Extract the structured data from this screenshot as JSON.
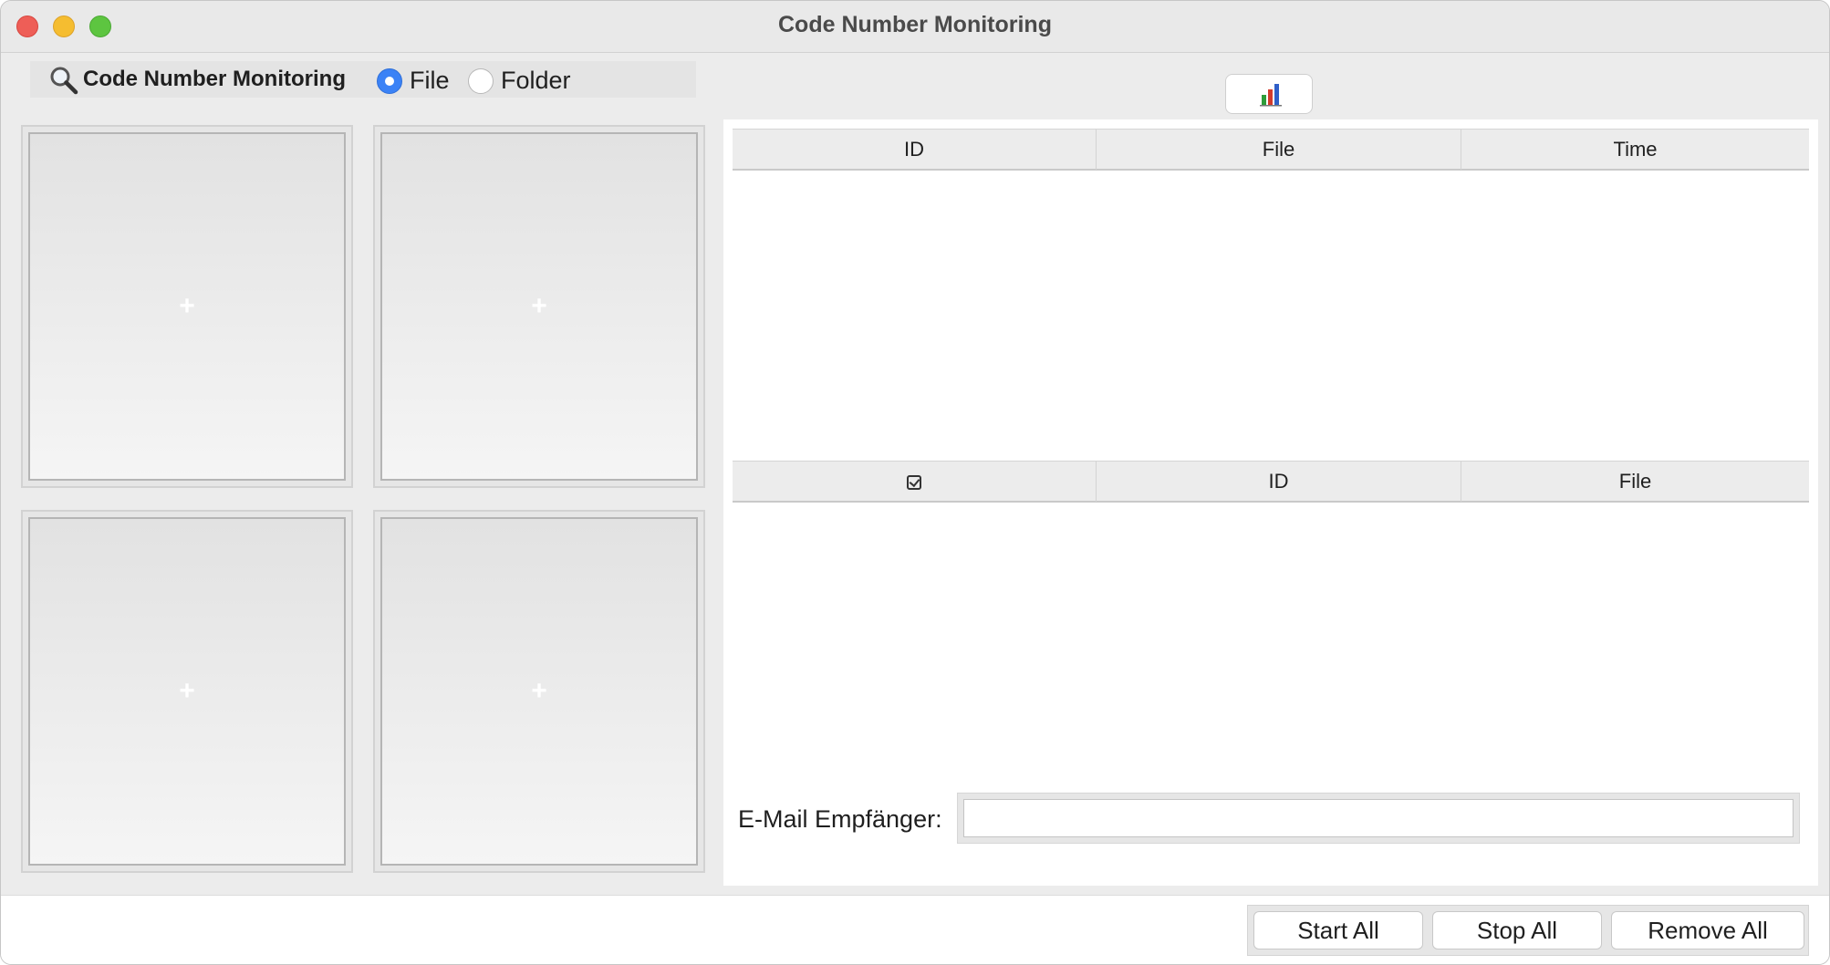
{
  "window": {
    "title": "Code Number Monitoring"
  },
  "toolbar": {
    "app_label": "Code Number Monitoring",
    "mode_options": [
      {
        "label": "File",
        "selected": true
      },
      {
        "label": "Folder",
        "selected": false
      }
    ]
  },
  "slots": [
    {
      "placeholder": "+"
    },
    {
      "placeholder": "+"
    },
    {
      "placeholder": "+"
    },
    {
      "placeholder": "+"
    }
  ],
  "log_table": {
    "columns": [
      "ID",
      "File",
      "Time"
    ],
    "rows": []
  },
  "recipients_table": {
    "columns": [
      "ID",
      "File"
    ],
    "rows": []
  },
  "email": {
    "label": "E-Mail Empfänger:",
    "value": ""
  },
  "actions": {
    "start_all": "Start All",
    "stop_all": "Stop All",
    "remove_all": "Remove All"
  },
  "colors": {
    "accent": "#3b82f6",
    "close": "#ee5e57",
    "minimize": "#f5bd30",
    "maximize": "#5dc540"
  },
  "icons": [
    "search-icon",
    "chart-icon",
    "check-icon"
  ]
}
